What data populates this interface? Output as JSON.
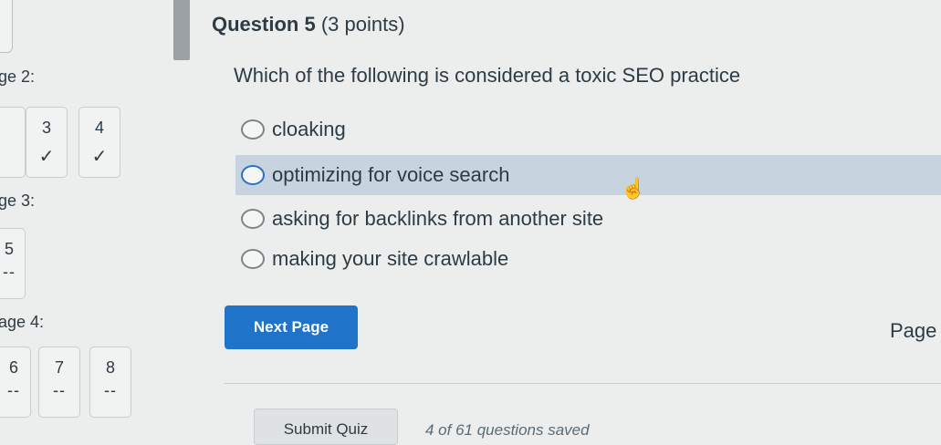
{
  "sidebar": {
    "sections": [
      {
        "label": "ge 2:",
        "questions": [
          {
            "num": "3",
            "status": "✓"
          },
          {
            "num": "4",
            "status": "✓"
          }
        ]
      },
      {
        "label": "ge 3:",
        "questions": [
          {
            "num": "5",
            "status": "--"
          }
        ]
      },
      {
        "label": "age 4:",
        "questions": [
          {
            "num": "6",
            "status": "--"
          },
          {
            "num": "7",
            "status": "--"
          },
          {
            "num": "8",
            "status": "--"
          }
        ]
      }
    ]
  },
  "question": {
    "number_label": "Question 5",
    "points_label": "(3 points)",
    "text": "Which of the following is considered a toxic SEO practice",
    "answers": [
      {
        "label": "cloaking"
      },
      {
        "label": "optimizing for voice search"
      },
      {
        "label": "asking for backlinks from another site"
      },
      {
        "label": "making your site crawlable"
      }
    ]
  },
  "nav": {
    "next_label": "Next Page",
    "page_label": "Page"
  },
  "footer": {
    "submit_label": "Submit Quiz",
    "saved_status": "4 of 61 questions saved"
  }
}
